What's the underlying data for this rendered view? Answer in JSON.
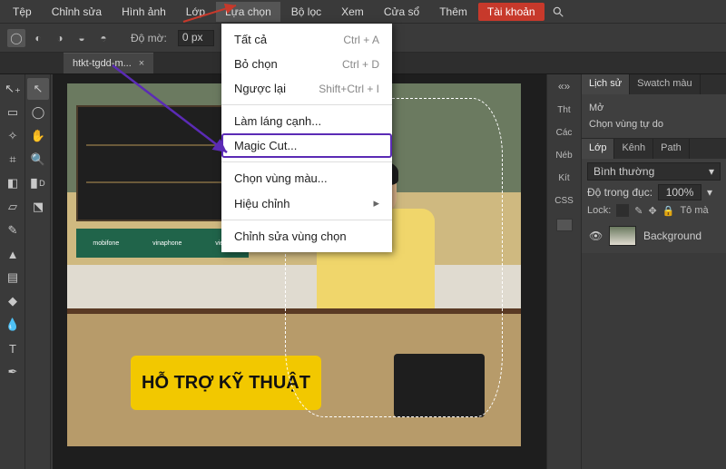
{
  "menubar": {
    "items": [
      "Tệp",
      "Chỉnh sửa",
      "Hình ảnh",
      "Lớp",
      "Lựa chọn",
      "Bộ lọc",
      "Xem",
      "Cửa sổ",
      "Thêm"
    ],
    "account": "Tài khoản"
  },
  "toolbar": {
    "opacity_label": "Độ mờ:",
    "opacity_value": "0 px"
  },
  "doc_tab": {
    "name": "htkt-tgdd-m...",
    "close": "×"
  },
  "dropdown": {
    "items": [
      {
        "label": "Tất cả",
        "shortcut": "Ctrl + A"
      },
      {
        "label": "Bỏ chọn",
        "shortcut": "Ctrl + D"
      },
      {
        "label": "Ngược lại",
        "shortcut": "Shift+Ctrl + I"
      },
      {
        "sep": true
      },
      {
        "label": "Làm láng cạnh..."
      },
      {
        "label": "Magic Cut...",
        "highlight": true
      },
      {
        "sep": true
      },
      {
        "label": "Chọn vùng màu..."
      },
      {
        "label": "Hiệu chỉnh",
        "submenu": true
      },
      {
        "sep": true
      },
      {
        "label": "Chỉnh sửa vùng chọn"
      }
    ]
  },
  "right_stub": {
    "expand": "«»",
    "labels": [
      "Tht",
      "Các",
      "Néb",
      "Kít",
      "CSS"
    ]
  },
  "history": {
    "tabs": [
      "Lịch sử",
      "Swatch màu"
    ],
    "items": [
      "Mở",
      "Chọn vùng tự do"
    ]
  },
  "layers": {
    "tabs": [
      "Lớp",
      "Kênh",
      "Path"
    ],
    "blend_mode": "Bình thường",
    "opacity_label": "Độ trong đục:",
    "opacity_value": "100%",
    "lock_label": "Lock:",
    "fill_label": "Tô mà",
    "items": [
      {
        "name": "Background"
      }
    ]
  },
  "canvas": {
    "sign_text": "HỖ TRỢ KỸ THUẬT",
    "logos": [
      "mobifone",
      "vinaphone",
      "viettel"
    ]
  },
  "colors": {
    "accent_red": "#c7392b",
    "highlight_purple": "#5b2bb5"
  }
}
